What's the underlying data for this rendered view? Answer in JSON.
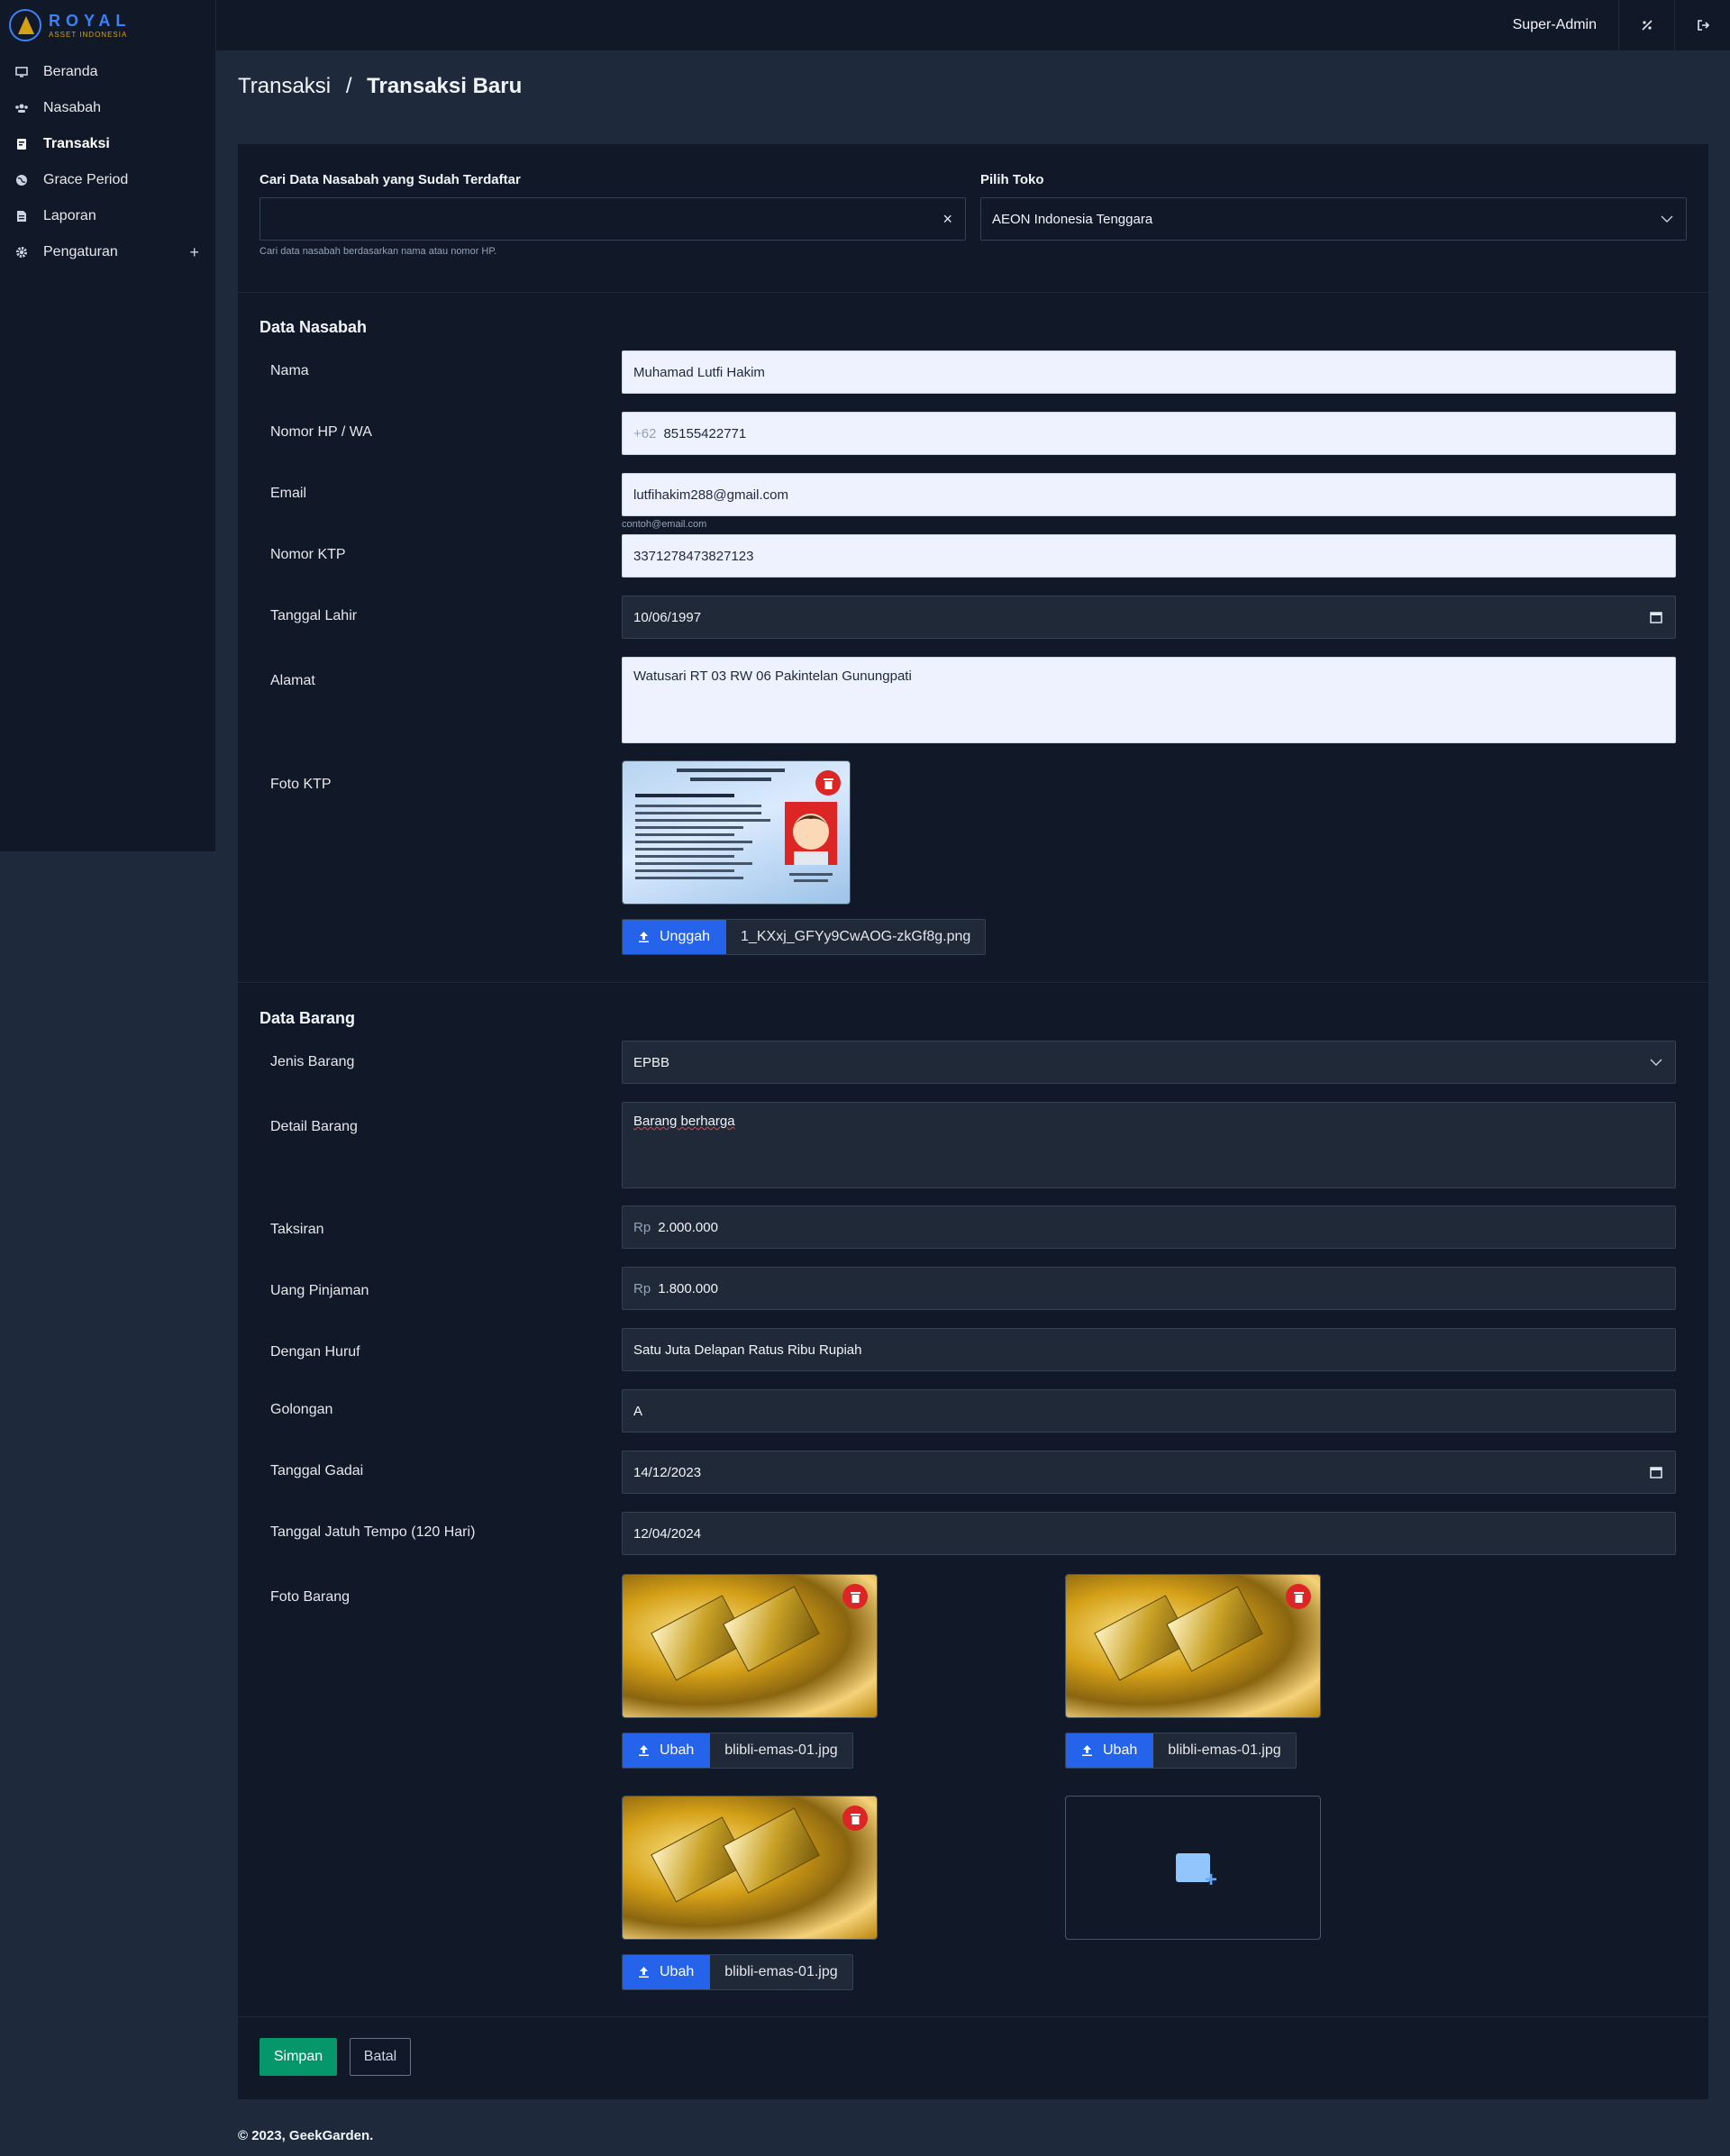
{
  "app": {
    "logo_title": "ROYAL",
    "logo_sub": "ASSET INDONESIA",
    "user": "Super-Admin"
  },
  "sidebar": {
    "items": [
      {
        "label": "Beranda",
        "icon": "monitor-icon"
      },
      {
        "label": "Nasabah",
        "icon": "users-icon"
      },
      {
        "label": "Transaksi",
        "icon": "receipt-icon"
      },
      {
        "label": "Grace Period",
        "icon": "globe-icon"
      },
      {
        "label": "Laporan",
        "icon": "document-icon"
      },
      {
        "label": "Pengaturan",
        "icon": "gear-icon"
      }
    ]
  },
  "breadcrumb": {
    "parent": "Transaksi",
    "separator": "/",
    "current": "Transaksi Baru"
  },
  "search": {
    "label": "Cari Data Nasabah yang Sudah Terdaftar",
    "value": "",
    "hint": "Cari data nasabah berdasarkan nama atau nomor HP.",
    "clear": "×"
  },
  "store": {
    "label": "Pilih Toko",
    "value": "AEON Indonesia Tenggara"
  },
  "customer": {
    "title": "Data Nasabah",
    "name_label": "Nama",
    "name": "Muhamad Lutfi Hakim",
    "phone_label": "Nomor HP / WA",
    "phone_prefix": "+62",
    "phone": "85155422771",
    "email_label": "Email",
    "email": "lutfihakim288@gmail.com",
    "email_hint": "contoh@email.com",
    "ktp_label": "Nomor KTP",
    "ktp": "3371278473827123",
    "dob_label": "Tanggal Lahir",
    "dob": "10/06/1997",
    "address_label": "Alamat",
    "address": "Watusari RT 03 RW 06 Pakintelan Gunungpati",
    "photo_label": "Foto KTP",
    "upload_label": "Unggah",
    "photo_file": "1_KXxj_GFYy9CwAOG-zkGf8g.png"
  },
  "item": {
    "title": "Data Barang",
    "type_label": "Jenis Barang",
    "type": "EPBB",
    "detail_label": "Detail Barang",
    "detail": "Barang berharga",
    "appraisal_label": "Taksiran",
    "currency": "Rp",
    "appraisal": "2.000.000",
    "loan_label": "Uang Pinjaman",
    "loan": "1.800.000",
    "words_label": "Dengan Huruf",
    "words": "Satu Juta Delapan Ratus Ribu Rupiah",
    "class_label": "Golongan",
    "class": "A",
    "pawn_date_label": "Tanggal Gadai",
    "pawn_date": "14/12/2023",
    "due_date_label": "Tanggal Jatuh Tempo (120 Hari)",
    "due_date": "12/04/2024",
    "photos_label": "Foto Barang",
    "change_label": "Ubah",
    "photos": [
      {
        "file": "blibli-emas-01.jpg"
      },
      {
        "file": "blibli-emas-01.jpg"
      },
      {
        "file": "blibli-emas-01.jpg"
      }
    ]
  },
  "actions": {
    "save": "Simpan",
    "cancel": "Batal"
  },
  "footer": {
    "text": "© 2023, GeekGarden."
  },
  "colors": {
    "primary": "#2563eb",
    "success": "#059669",
    "danger": "#dc2626",
    "bg": "#1e293b",
    "panel": "#111827"
  }
}
